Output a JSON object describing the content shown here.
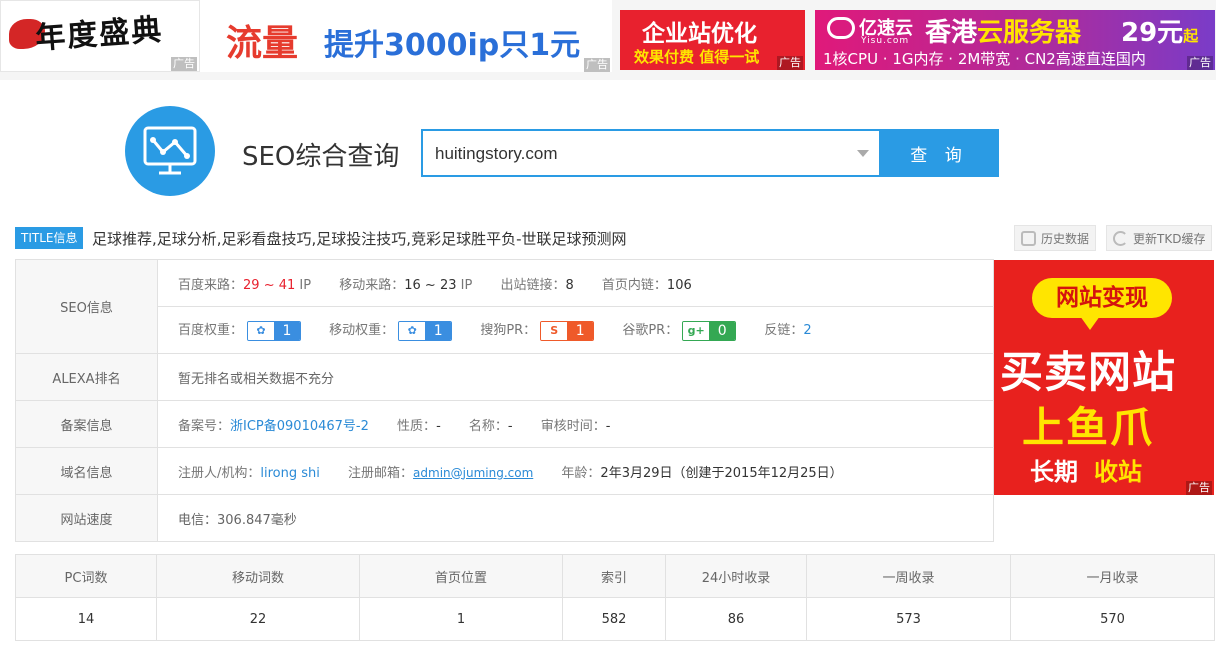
{
  "ads": {
    "banner1": {
      "text": "年度盛典",
      "tag": "广告"
    },
    "banner2": {
      "big": "流量",
      "rest": "提升3000ip只1元",
      "tag": "广告"
    },
    "banner3": {
      "line1": "企业站优化",
      "line2": "效果付费 值得一试",
      "tag": "广告"
    },
    "banner4": {
      "brand": "亿速云",
      "brand_sub": "Yisu.com",
      "head_pre": "香港",
      "head_hl": "云服务器",
      "price": "29元",
      "price_unit": "起",
      "spec": "1核CPU · 1G内存 · 2M带宽 · CN2高速直连国内",
      "tag": "广告"
    },
    "right": {
      "bubble": "网站变现",
      "line1": "买卖网站",
      "line2": "上鱼爪",
      "line3a": "长期",
      "line3b": "收站",
      "tag": "广告"
    }
  },
  "search": {
    "title": "SEO综合查询",
    "value": "huitingstory.com",
    "button": "查 询"
  },
  "title_info": {
    "badge": "TITLE信息",
    "text": "足球推荐,足球分析,足彩看盘技巧,足球投注技巧,竞彩足球胜平负-世联足球预测网",
    "history_btn": "历史数据",
    "tkd_btn": "更新TKD缓存"
  },
  "info": {
    "seo_label": "SEO信息",
    "baidu_traffic_label": "百度来路：",
    "baidu_traffic_value": "29 ~ 41",
    "ip_unit": "IP",
    "mobile_traffic_label": "移动来路：",
    "mobile_traffic_value": "16 ~ 23",
    "outlinks_label": "出站链接：",
    "outlinks_value": "8",
    "homepage_links_label": "首页内链：",
    "homepage_links_value": "106",
    "baidu_weight_label": "百度权重：",
    "baidu_weight_value": "1",
    "mobile_weight_label": "移动权重：",
    "mobile_weight_value": "1",
    "sogou_label": "搜狗PR：",
    "sogou_value": "1",
    "google_label": "谷歌PR：",
    "google_value": "0",
    "backlinks_label": "反链：",
    "backlinks_value": "2",
    "alexa_label": "ALEXA排名",
    "alexa_value": "暂无排名或相关数据不充分",
    "icp_label": "备案信息",
    "icp_no_label": "备案号：",
    "icp_no_value": "浙ICP备09010467号-2",
    "nature_label": "性质：",
    "nature_value": "-",
    "name_label": "名称：",
    "name_value": "-",
    "audit_label": "审核时间：",
    "audit_value": "-",
    "domain_label": "域名信息",
    "registrant_label": "注册人/机构：",
    "registrant_value": "lirong shi",
    "email_label": "注册邮箱：",
    "email_value": "admin@juming.com",
    "age_label": "年龄：",
    "age_value": "2年3月29日（创建于2015年12月25日）",
    "speed_label": "网站速度",
    "speed_value": "电信：306.847毫秒"
  },
  "stats": {
    "headers": [
      "PC词数",
      "移动词数",
      "首页位置",
      "索引",
      "24小时收录",
      "一周收录",
      "一月收录"
    ],
    "values": [
      "14",
      "22",
      "1",
      "582",
      "86",
      "573",
      "570"
    ]
  },
  "colors": {
    "accent": "#2a9be4",
    "ad_red": "#e8211e",
    "highlight_red": "#e8212e",
    "link_blue": "#2a8ad6"
  }
}
